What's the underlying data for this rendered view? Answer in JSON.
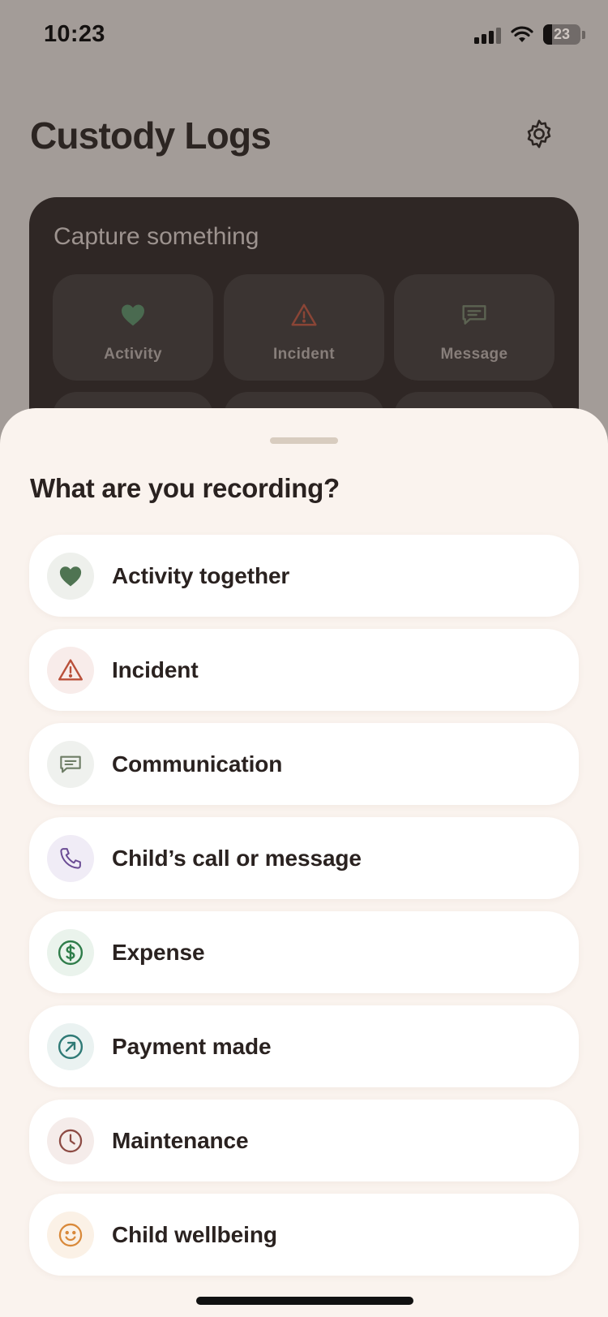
{
  "status_bar": {
    "time": "10:23",
    "battery": "23",
    "battery_level": 0.23
  },
  "app": {
    "title": "Custody Logs",
    "settings_icon": "gear-icon"
  },
  "capture": {
    "title": "Capture something",
    "tiles": [
      {
        "label": "Activity",
        "icon": "heart-icon",
        "color": "#4f6e55"
      },
      {
        "label": "Incident",
        "icon": "warning-icon",
        "color": "#8a4a3a"
      },
      {
        "label": "Message",
        "icon": "message-icon",
        "color": "#5f6655"
      }
    ]
  },
  "sheet": {
    "title": "What are you recording?",
    "options": [
      {
        "label": "Activity together",
        "icon": "heart-icon",
        "color": "#4f7452",
        "bg": "#eef0ec"
      },
      {
        "label": "Incident",
        "icon": "warning-icon",
        "color": "#b9503a",
        "bg": "#f8ecea"
      },
      {
        "label": "Communication",
        "icon": "message-icon",
        "color": "#6e7d66",
        "bg": "#eff1ee"
      },
      {
        "label": "Child’s call or message",
        "icon": "phone-icon",
        "color": "#6a4b94",
        "bg": "#f0ecf6"
      },
      {
        "label": "Expense",
        "icon": "dollar-icon",
        "color": "#2f7d4a",
        "bg": "#eaf3ec"
      },
      {
        "label": "Payment made",
        "icon": "arrow-up-right-icon",
        "color": "#2f7a76",
        "bg": "#eaf2f1"
      },
      {
        "label": "Maintenance",
        "icon": "clock-icon",
        "color": "#8d4b44",
        "bg": "#f5ecea"
      },
      {
        "label": "Child wellbeing",
        "icon": "smile-icon",
        "color": "#d9893a",
        "bg": "#fbf1e6"
      }
    ]
  }
}
